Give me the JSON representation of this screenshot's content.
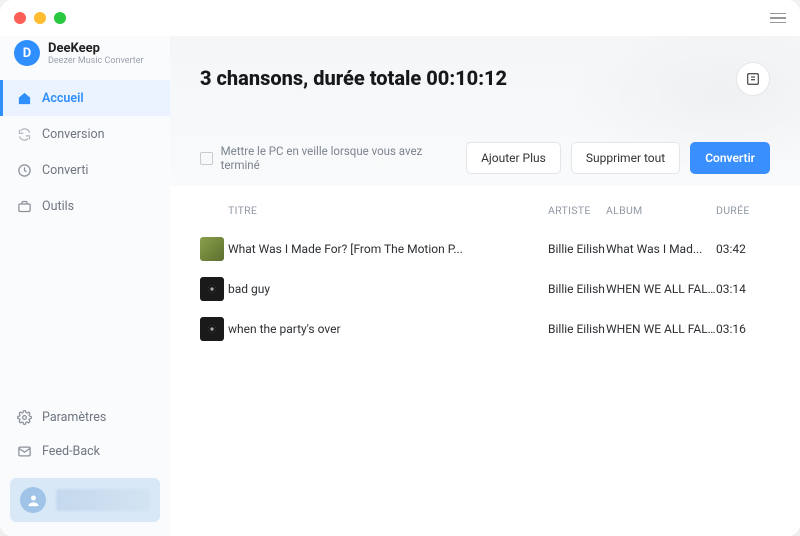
{
  "brand": {
    "name": "DeeKeep",
    "tagline": "Deezer Music Converter",
    "initial": "D"
  },
  "nav": {
    "home": {
      "label": "Accueil"
    },
    "conversion": {
      "label": "Conversion"
    },
    "converted": {
      "label": "Converti"
    },
    "tools": {
      "label": "Outils"
    },
    "settings": {
      "label": "Paramètres"
    },
    "feedback": {
      "label": "Feed-Back"
    }
  },
  "header": {
    "title": "3 chansons, durée totale 00:10:12"
  },
  "toolbar": {
    "sleep_label": "Mettre le PC en veille lorsque vous avez terminé",
    "add_label": "Ajouter Plus",
    "delete_label": "Supprimer tout",
    "convert_label": "Convertir"
  },
  "columns": {
    "title": "TITRE",
    "artist": "ARTISTE",
    "album": "ALBUM",
    "duration": "DURÉE"
  },
  "tracks": [
    {
      "title": "What Was I Made For? [From The Motion P...",
      "artist": "Billie Eilish",
      "album": "What Was I Mad...",
      "duration": "03:42"
    },
    {
      "title": "bad guy",
      "artist": "Billie Eilish",
      "album": "WHEN WE ALL FAL...",
      "duration": "03:14"
    },
    {
      "title": "when the party's over",
      "artist": "Billie Eilish",
      "album": "WHEN WE ALL FAL...",
      "duration": "03:16"
    }
  ]
}
